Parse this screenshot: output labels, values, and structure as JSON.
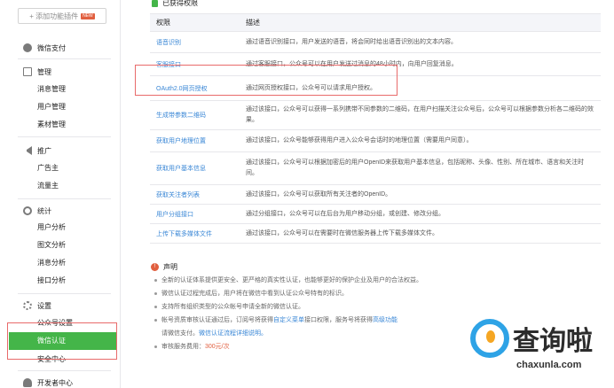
{
  "sidebar": {
    "add_plugin_label": "+ 添加功能插件",
    "add_plugin_badge": "NEW",
    "wechat_pay": "微信支付",
    "manage": {
      "title": "管理",
      "items": [
        "消息管理",
        "用户管理",
        "素材管理"
      ]
    },
    "promotion": {
      "title": "推广",
      "items": [
        "广告主",
        "流量主"
      ]
    },
    "stats": {
      "title": "统计",
      "items": [
        "用户分析",
        "图文分析",
        "消息分析",
        "接口分析"
      ]
    },
    "settings": {
      "title": "设置",
      "items": [
        "公众号设置",
        "微信认证",
        "安全中心"
      ]
    },
    "developer": "开发者中心"
  },
  "permissions": {
    "title": "已获得权限",
    "columns": [
      "权限",
      "描述"
    ],
    "rows": [
      {
        "name": "语音识别",
        "desc": "通过语音识别接口，用户发送的语音，将会同时给出语音识别出的文本内容。"
      },
      {
        "name": "客服接口",
        "desc": "通过客服接口，公众号可以在用户发送过消息的48小时内，向用户回复消息。"
      },
      {
        "name": "OAuth2.0网页授权",
        "desc": "通过网页授权接口，公众号可以请求用户授权。"
      },
      {
        "name": "生成带参数二维码",
        "desc": "通过该接口，公众号可以获得一系列携带不同参数的二维码，在用户扫描关注公众号后，公众号可以根据参数分析各二维码的效果。"
      },
      {
        "name": "获取用户地理位置",
        "desc": "通过该接口，公众号能够获得用户进入公众号会话时的地理位置（需要用户同意）。"
      },
      {
        "name": "获取用户基本信息",
        "desc": "通过该接口，公众号可以根据加密后的用户OpenID来获取用户基本信息，包括昵称、头像、性别、所在城市、语言和关注时间。"
      },
      {
        "name": "获取关注者列表",
        "desc": "通过该接口，公众号可以获取所有关注者的OpenID。"
      },
      {
        "name": "用户分组接口",
        "desc": "通过分组接口，公众号可以在后台为用户移动分组，或创建、修改分组。"
      },
      {
        "name": "上传下载多媒体文件",
        "desc": "通过该接口，公众号可以在需要时在微信服务器上传下载多媒体文件。"
      }
    ]
  },
  "declaration": {
    "title": "声明",
    "items": [
      "全新的认证体系提供更安全、更严格的真实性认证，也能够更好的保护企业及用户的合法权益。",
      "微信认证过程完成后，用户将在微信中看到认证公众号特有的标识。",
      "支持所有组织类型的公众帐号申请全新的微信认证。",
      "帐号资质审核认证通过后，订阅号将获得",
      "自定义菜单",
      "接口权限，服务号将获得",
      "高级功能",
      "请微信支付。",
      "微信认证流程详细说明。",
      "审核服务费用：",
      "300元/次"
    ]
  },
  "watermark": {
    "text": "查询啦",
    "domain": "chaxunla.com"
  }
}
